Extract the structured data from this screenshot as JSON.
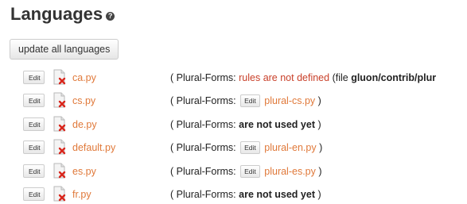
{
  "header": {
    "title": "Languages",
    "help_icon": "question-circle-icon"
  },
  "toolbar": {
    "update_label": "update all languages"
  },
  "rows": [
    {
      "edit": "Edit",
      "file": "ca.py",
      "paren_open": "( ",
      "prefix": "Plural-Forms: ",
      "status": "rules are not defined",
      "status_color": "#c9402a",
      "note_open": " (file ",
      "note_bold": "gluon/contrib/plur",
      "plural_file": "",
      "paren_close": ""
    },
    {
      "edit": "Edit",
      "file": "cs.py",
      "paren_open": "( ",
      "prefix": "Plural-Forms: ",
      "mini_edit": "Edit",
      "plural_file": "plural-cs.py",
      "paren_close": " )"
    },
    {
      "edit": "Edit",
      "file": "de.py",
      "paren_open": "( ",
      "prefix": "Plural-Forms: ",
      "bold": "are not used yet",
      "paren_close": " )"
    },
    {
      "edit": "Edit",
      "file": "default.py",
      "paren_open": "( ",
      "prefix": "Plural-Forms: ",
      "mini_edit": "Edit",
      "plural_file": "plural-en.py",
      "paren_close": " )"
    },
    {
      "edit": "Edit",
      "file": "es.py",
      "paren_open": "( ",
      "prefix": "Plural-Forms: ",
      "mini_edit": "Edit",
      "plural_file": "plural-es.py",
      "paren_close": " )"
    },
    {
      "edit": "Edit",
      "file": "fr.py",
      "paren_open": "( ",
      "prefix": "Plural-Forms: ",
      "bold": "are not used yet",
      "paren_close": " )"
    }
  ],
  "colors": {
    "link": "#e0793a",
    "error": "#c9402a",
    "text": "#222222"
  }
}
